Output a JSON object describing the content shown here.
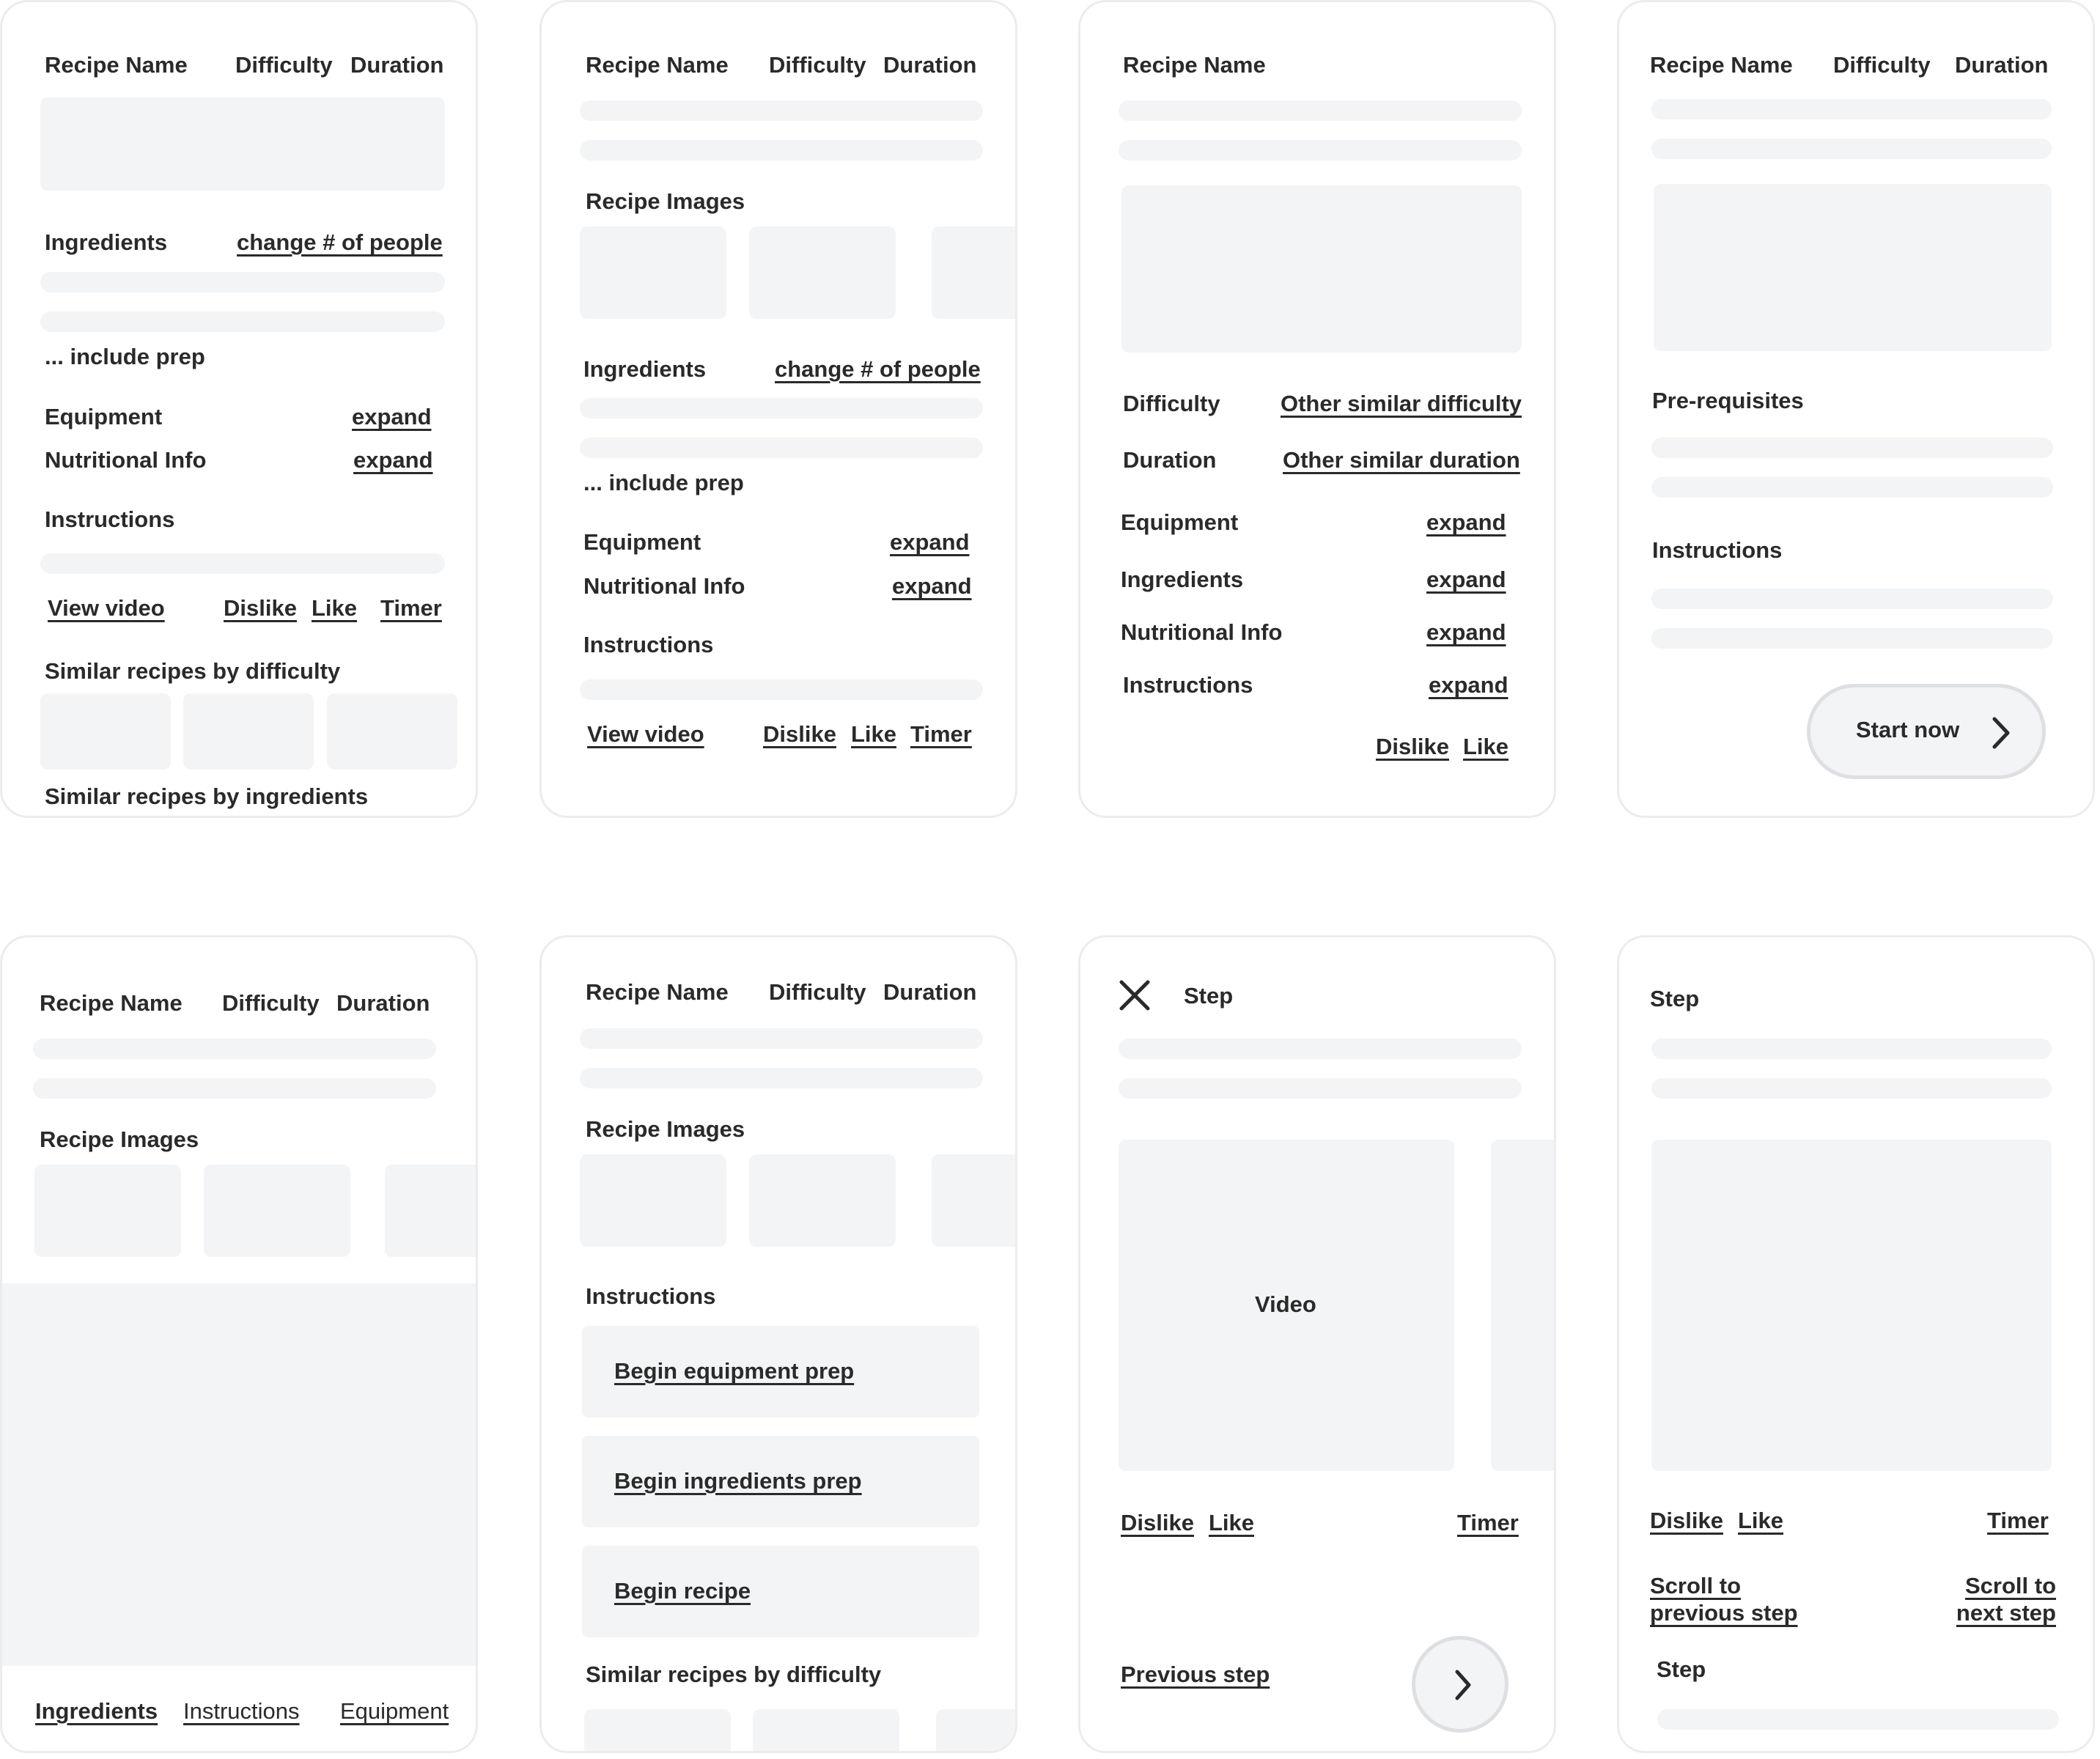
{
  "common": {
    "recipe_name": "Recipe Name",
    "difficulty": "Difficulty",
    "duration": "Duration",
    "ingredients": "Ingredients",
    "change_people": "change # of people",
    "include_prep": "... include prep",
    "equipment": "Equipment",
    "nutritional_info": "Nutritional Info",
    "instructions": "Instructions",
    "expand": "expand",
    "view_video": "View video",
    "dislike": "Dislike",
    "like": "Like",
    "timer": "Timer",
    "recipe_images": "Recipe Images",
    "similar_by_difficulty": "Similar recipes by difficulty",
    "similar_by_ingredients": "Similar recipes by ingredients",
    "step": "Step"
  },
  "screen3": {
    "other_difficulty": "Other similar difficulty",
    "other_duration": "Other similar duration"
  },
  "screen4": {
    "prerequisites": "Pre-requisites",
    "start_now": "Start now"
  },
  "screen5": {
    "tabs": [
      "Ingredients",
      "Instructions",
      "Equipment"
    ]
  },
  "screen6": {
    "begin_equipment": "Begin equipment prep",
    "begin_ingredients": "Begin ingredients prep",
    "begin_recipe": "Begin recipe"
  },
  "screen7": {
    "video": "Video",
    "previous_step": "Previous step"
  },
  "screen8": {
    "scroll_prev": "Scroll to previous step",
    "scroll_next": "Scroll to next step"
  }
}
